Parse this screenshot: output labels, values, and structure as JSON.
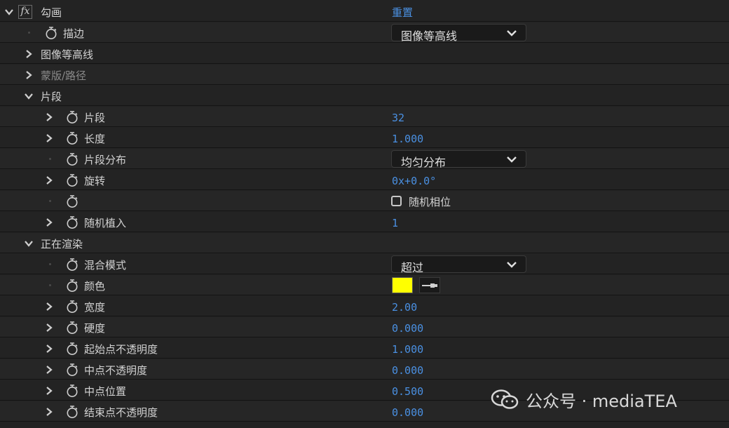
{
  "effect": {
    "name": "勾画",
    "reset_label": "重置"
  },
  "rows": {
    "stroke": {
      "label": "描边",
      "value": "图像等高线"
    },
    "image_contours": {
      "label": "图像等高线"
    },
    "mask_path": {
      "label": "蒙版/路径"
    },
    "segments_group": {
      "label": "片段"
    },
    "segments": {
      "label": "片段",
      "value": "32"
    },
    "length": {
      "label": "长度",
      "value": "1.000"
    },
    "segment_distribution": {
      "label": "片段分布",
      "value": "均匀分布"
    },
    "rotation": {
      "label": "旋转",
      "value": "0x+0.0°"
    },
    "random_phase": {
      "label": "",
      "checkbox_label": "随机相位"
    },
    "random_seed": {
      "label": "随机植入",
      "value": "1"
    },
    "rendering_group": {
      "label": "正在渲染"
    },
    "blend_mode": {
      "label": "混合模式",
      "value": "超过"
    },
    "color": {
      "label": "颜色",
      "swatch": "#ffff00"
    },
    "width": {
      "label": "宽度",
      "value": "2.00"
    },
    "hardness": {
      "label": "硬度",
      "value": "0.000"
    },
    "start_opacity": {
      "label": "起始点不透明度",
      "value": "1.000"
    },
    "mid_opacity": {
      "label": "中点不透明度",
      "value": "0.000"
    },
    "mid_position": {
      "label": "中点位置",
      "value": "0.500"
    },
    "end_opacity": {
      "label": "结束点不透明度",
      "value": "0.000"
    }
  },
  "watermark": {
    "text": "公众号 · mediaTEA"
  },
  "colors": {
    "accent": "#4a90e2",
    "background": "#232323",
    "swatch_yellow": "#ffff00"
  }
}
